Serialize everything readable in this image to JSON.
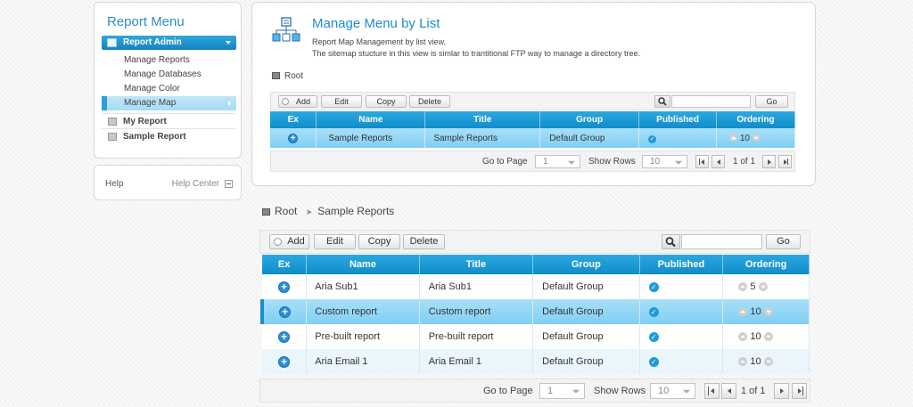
{
  "sidebar": {
    "title": "Report Menu",
    "header": "Report Admin",
    "items": [
      "Manage Reports",
      "Manage Databases",
      "Manage Color",
      "Manage Map"
    ],
    "groups": [
      "My Report",
      "Sample Report"
    ],
    "help_label": "Help",
    "help_center": "Help Center"
  },
  "top": {
    "title": "Manage Menu by List",
    "desc1": "Report Map Management by list view,",
    "desc2": "The sitemap stucture in this view is simlar to trantitional FTP way to manage a directory tree.",
    "crumb": "Root",
    "buttons": {
      "add": "Add",
      "edit": "Edit",
      "copy": "Copy",
      "delete": "Delete",
      "go": "Go"
    },
    "columns": [
      "Ex",
      "Name",
      "Title",
      "Group",
      "Published",
      "Ordering"
    ],
    "rows": [
      {
        "name": "Sample Reports",
        "title": "Sample Reports",
        "group": "Default Group",
        "ordering": "10"
      }
    ],
    "pager": {
      "goto_label": "Go to Page",
      "page": "1",
      "show_rows_label": "Show Rows",
      "rows": "10",
      "page_info": "1 of 1"
    }
  },
  "bottom": {
    "crumb_root": "Root",
    "crumb_current": "Sample Reports",
    "buttons": {
      "add": "Add",
      "edit": "Edit",
      "copy": "Copy",
      "delete": "Delete",
      "go": "Go"
    },
    "columns": [
      "Ex",
      "Name",
      "Title",
      "Group",
      "Published",
      "Ordering"
    ],
    "rows": [
      {
        "name": "Aria Sub1",
        "title": "Aria Sub1",
        "group": "Default Group",
        "ordering": "5"
      },
      {
        "name": "Custom report",
        "title": "Custom report",
        "group": "Default Group",
        "ordering": "10"
      },
      {
        "name": "Pre-built report",
        "title": "Pre-built report",
        "group": "Default Group",
        "ordering": "10"
      },
      {
        "name": "Aria Email 1",
        "title": "Aria Email 1",
        "group": "Default Group",
        "ordering": "10"
      }
    ],
    "pager": {
      "goto_label": "Go to Page",
      "page": "1",
      "show_rows_label": "Show Rows",
      "rows": "10",
      "page_info": "1 of 1"
    }
  },
  "colors": {
    "accent": "#1e8ccd",
    "header_blue": "#128bcb",
    "selected_row": "#80cef3"
  }
}
